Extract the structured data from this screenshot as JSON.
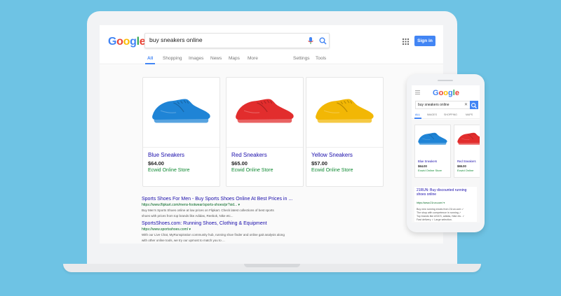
{
  "desktop": {
    "logo": "Google",
    "search": {
      "value": "buy sneakers online"
    },
    "signin_label": "Sign in",
    "tabs": [
      {
        "label": "All",
        "active": true
      },
      {
        "label": "Shopping"
      },
      {
        "label": "Images"
      },
      {
        "label": "News"
      },
      {
        "label": "Maps"
      },
      {
        "label": "More"
      },
      {
        "label": "Settings"
      },
      {
        "label": "Tools"
      }
    ],
    "products": [
      {
        "name": "Blue Sneakers",
        "price": "$64.00",
        "store": "Ecwid Online Store",
        "color": "#1f84d6"
      },
      {
        "name": "Red Sneakers",
        "price": "$65.00",
        "store": "Ecwid Online Store",
        "color": "#e22d2d"
      },
      {
        "name": "Yellow Sneakers",
        "price": "$57.00",
        "store": "Ecwid Online Store",
        "color": "#f2b705"
      }
    ],
    "results": [
      {
        "title": "Sports Shoes For Men - Buy Sports Shoes Online At Best Prices in ...",
        "url": "https://www.flipkart.com/mens-footwear/sports-shoes/pr?sid... ▾",
        "snippet_line1": "Buy Men's Sports Shoes online at low prices on Flipkart. Check latest collections of best sports",
        "snippet_line2": "shoes with prices from top brands like Adidas, Reebok, Nike etc..."
      },
      {
        "title": "SportsShoes.com: Running Shoes, Clothing & Equipment",
        "url": "https://www.sportsshoes.com/ ▾",
        "snippet_line1": "With our Live Chat, MyRunspiration community hub, running shoe finder and online gait analysis along",
        "snippet_line2": "with other online tools, we try our upmost to match you to ..."
      }
    ]
  },
  "mobile": {
    "logo": "Google",
    "search": {
      "value": "buy sneakers online",
      "clear": "✕"
    },
    "tabs": [
      {
        "label": "ALL",
        "active": true
      },
      {
        "label": "IMAGES"
      },
      {
        "label": "SHOPPING"
      },
      {
        "label": "MAPS"
      }
    ],
    "products": [
      {
        "name": "Blue Sneakers",
        "price": "$64.00",
        "store": "Ecwid Online Store",
        "color": "#1f84d6"
      },
      {
        "name": "Red Sneakers",
        "price": "$65.00",
        "store": "Ecwid Online",
        "color": "#e22d2d"
      }
    ],
    "result": {
      "title": "21RUN: Buy discounted running shoes online",
      "url": "https://www.21run.com/ ▾",
      "snippet_line1": "Buy new running shoes from 21run.com ✓",
      "snippet_line2": "The shop with competence in running ✓",
      "snippet_line3": "Top brands like ASICS, adidas, Nike etc. ✓",
      "snippet_line4": "Fast delivery ✓ Large selection."
    }
  },
  "colors": {
    "background": "#6ec3e4",
    "google_blue": "#4285f4",
    "google_red": "#ea4335",
    "google_yellow": "#fbbc05",
    "google_green": "#34a853",
    "link": "#1a0dab",
    "store_green": "#108a33"
  }
}
